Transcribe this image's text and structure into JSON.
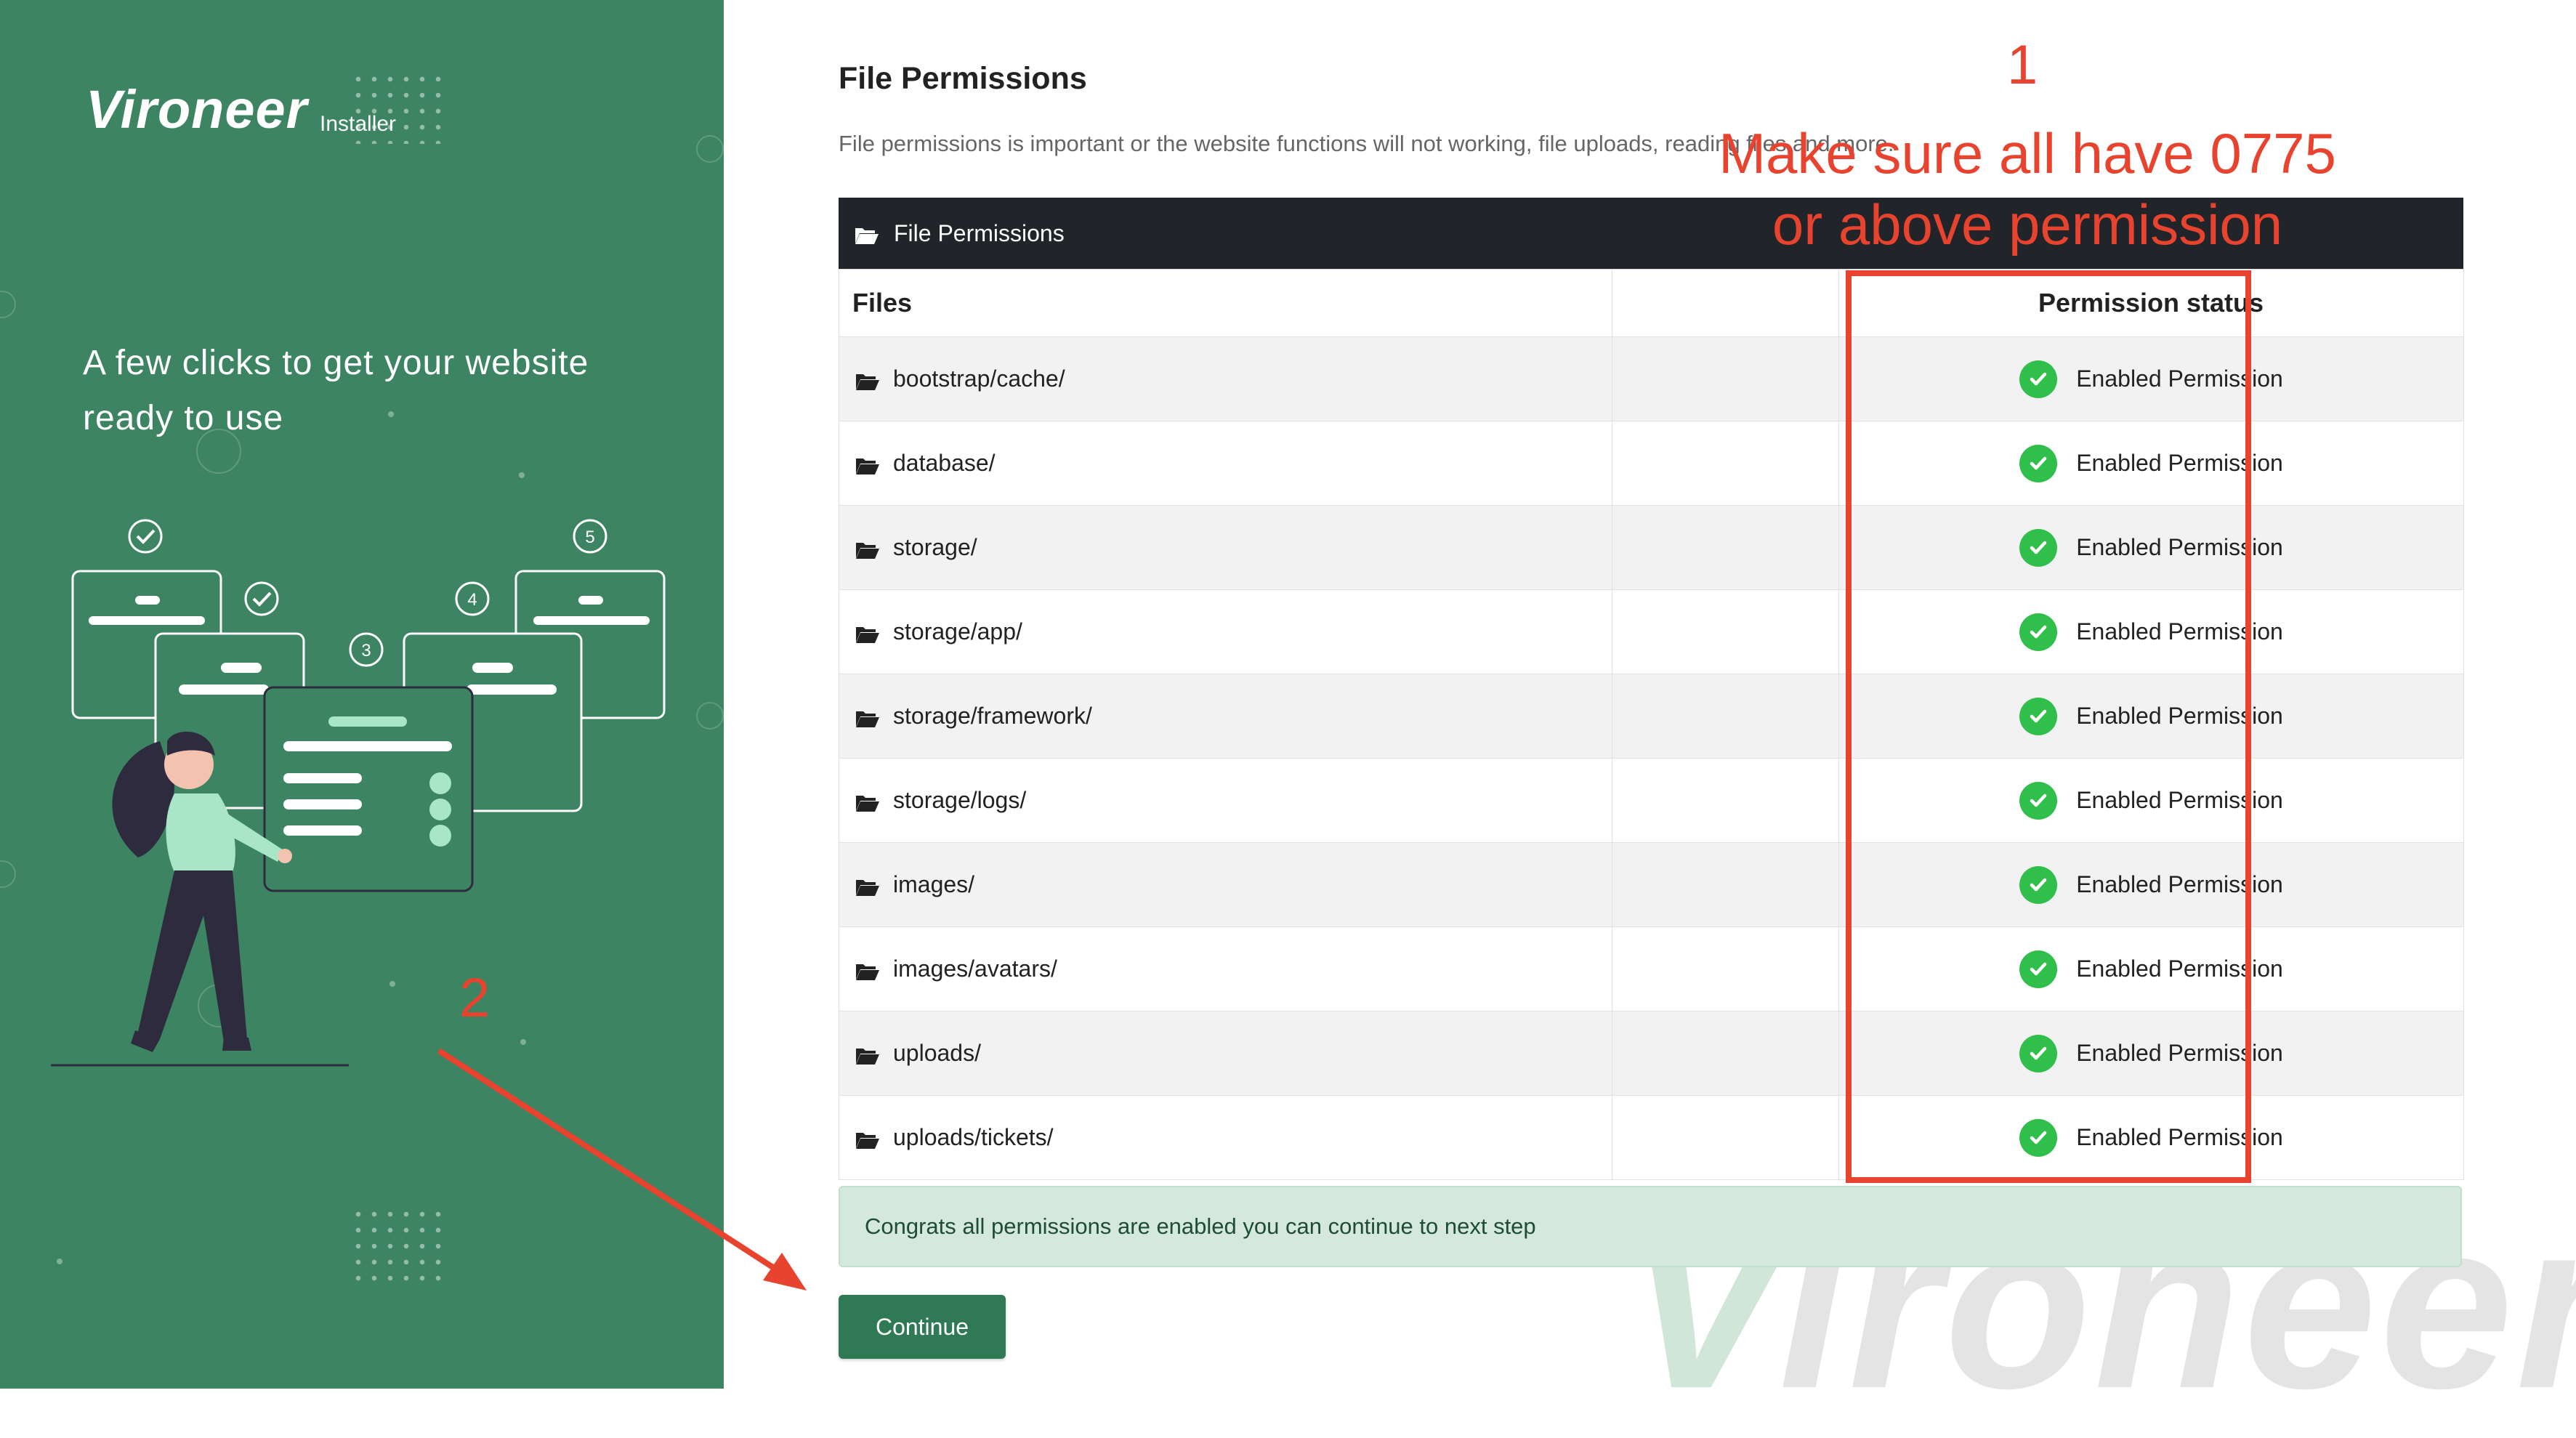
{
  "sidebar": {
    "brand": "Vironeer",
    "brand_sub": "Installer",
    "tagline": "A few clicks to get your website ready to use",
    "steps": [
      "3",
      "4",
      "5"
    ]
  },
  "main": {
    "title": "File Permissions",
    "description": "File permissions is important or the website functions will not working, file uploads, reading files and more.",
    "card_title": "File Permissions",
    "columns": {
      "files": "Files",
      "status": "Permission status"
    },
    "rows": [
      {
        "file": "bootstrap/cache/",
        "status": "Enabled Permission"
      },
      {
        "file": "database/",
        "status": "Enabled Permission"
      },
      {
        "file": "storage/",
        "status": "Enabled Permission"
      },
      {
        "file": "storage/app/",
        "status": "Enabled Permission"
      },
      {
        "file": "storage/framework/",
        "status": "Enabled Permission"
      },
      {
        "file": "storage/logs/",
        "status": "Enabled Permission"
      },
      {
        "file": "images/",
        "status": "Enabled Permission"
      },
      {
        "file": "images/avatars/",
        "status": "Enabled Permission"
      },
      {
        "file": "uploads/",
        "status": "Enabled Permission"
      },
      {
        "file": "uploads/tickets/",
        "status": "Enabled Permission"
      }
    ],
    "alert": "Congrats all permissions are enabled you can continue to next step",
    "continue_label": "Continue",
    "watermark": "Vironeer"
  },
  "annotations": {
    "num1": "1",
    "text1_line1": "Make sure all have 0775",
    "text1_line2": "or above permission",
    "num2": "2"
  },
  "colors": {
    "sidebar": "#3c8462",
    "accent": "#2f7a55",
    "check": "#2fbf4a",
    "annotation": "#e8432e",
    "header": "#212529"
  },
  "icons": {
    "folder": "folder-open-icon",
    "check": "check-circle-icon"
  }
}
